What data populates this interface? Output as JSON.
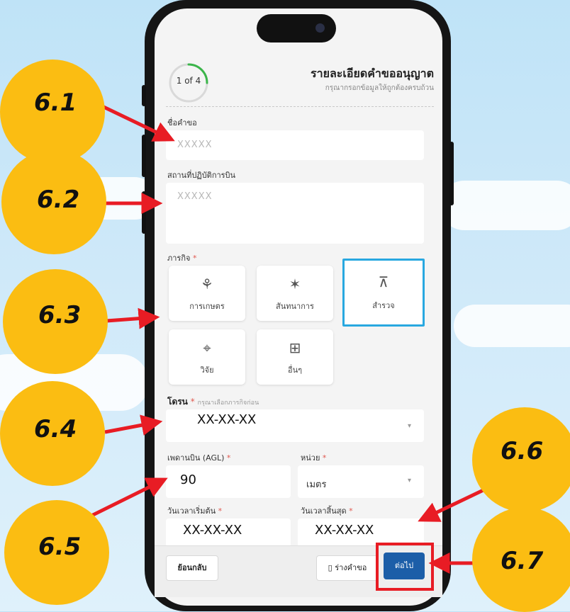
{
  "header": {
    "progress": "1 of 4",
    "progress_fraction": 0.25,
    "title": "รายละเอียดคำขออนุญาต",
    "subtitle": "กรุณากรอกข้อมูลให้ถูกต้องครบถ้วน"
  },
  "form": {
    "request_name": {
      "label": "ชื่อคำขอ",
      "placeholder": "XXXXX"
    },
    "location": {
      "label": "สถานที่ปฏิบัติการบิน",
      "placeholder": "XXXXX"
    },
    "mission": {
      "label": "ภารกิจ",
      "required_mark": "*",
      "options": [
        {
          "label": "การเกษตร",
          "icon": "agriculture-icon",
          "selected": false
        },
        {
          "label": "สันทนาการ",
          "icon": "recreation-icon",
          "selected": false
        },
        {
          "label": "สำรวจ",
          "icon": "survey-tripod-icon",
          "selected": true
        },
        {
          "label": "วิจัย",
          "icon": "research-drone-icon",
          "selected": false
        },
        {
          "label": "อื่นๆ",
          "icon": "apps-plus-icon",
          "selected": false
        }
      ]
    },
    "drone": {
      "label": "โดรน",
      "required_mark": "*",
      "hint": "กรุณาเลือกภารกิจก่อน",
      "value": "XX-XX-XX"
    },
    "ceiling": {
      "label": "เพดานบิน (AGL)",
      "required_mark": "*",
      "value": "90"
    },
    "unit": {
      "label": "หน่วย",
      "required_mark": "*",
      "value": "เมตร"
    },
    "start": {
      "label": "วันเวลาเริ่มต้น",
      "required_mark": "*",
      "value": "XX-XX-XX"
    },
    "end": {
      "label": "วันเวลาสิ้นสุด",
      "required_mark": "*",
      "value": "XX-XX-XX"
    }
  },
  "footer": {
    "back_label": "ย้อนกลับ",
    "draft_label": "ร่างคำขอ",
    "next_label": "ต่อไป"
  },
  "callouts": [
    "6.1",
    "6.2",
    "6.3",
    "6.4",
    "6.5",
    "6.6",
    "6.7"
  ],
  "colors": {
    "callout": "#fbbd12",
    "arrow": "#e81c24",
    "primary_button": "#1c5ea8",
    "selected_border": "#29a8e0",
    "progress_ring": "#3bb54a"
  }
}
